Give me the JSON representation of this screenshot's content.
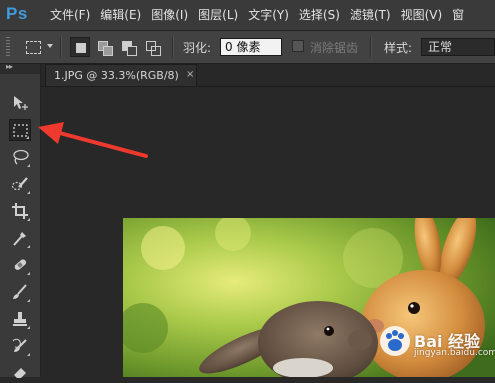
{
  "app": {
    "logo": "Ps"
  },
  "menu": {
    "items": [
      {
        "label": "文件(F)"
      },
      {
        "label": "编辑(E)"
      },
      {
        "label": "图像(I)"
      },
      {
        "label": "图层(L)"
      },
      {
        "label": "文字(Y)"
      },
      {
        "label": "选择(S)"
      },
      {
        "label": "滤镜(T)"
      },
      {
        "label": "视图(V)"
      },
      {
        "label": "窗"
      }
    ]
  },
  "options": {
    "feather_label": "羽化:",
    "feather_value": "0 像素",
    "antialias_label": "消除锯齿",
    "style_label": "样式:",
    "style_value": "正常"
  },
  "document": {
    "tab_title": "1.JPG @ 33.3%(RGB/8)",
    "tab_close": "×"
  },
  "watermark": {
    "text": "Bai 经验",
    "url": "jingyan.baidu.com"
  },
  "tools": [
    {
      "name": "move-tool",
      "icon": "move-arrow-icon"
    },
    {
      "name": "rectangular-marquee-tool",
      "icon": "dashed-rectangle-icon",
      "selected": true
    },
    {
      "name": "lasso-tool",
      "icon": "lasso-icon"
    },
    {
      "name": "quick-selection-tool",
      "icon": "quick-selection-brush-icon"
    },
    {
      "name": "crop-tool",
      "icon": "crop-icon"
    },
    {
      "name": "eyedropper-tool",
      "icon": "eyedropper-icon"
    },
    {
      "name": "healing-brush-tool",
      "icon": "bandage-icon"
    },
    {
      "name": "brush-tool",
      "icon": "brush-icon"
    },
    {
      "name": "clone-stamp-tool",
      "icon": "stamp-icon"
    },
    {
      "name": "history-brush-tool",
      "icon": "history-brush-icon"
    },
    {
      "name": "eraser-tool",
      "icon": "eraser-icon"
    }
  ],
  "colors": {
    "menubar": "#3a3a3a",
    "options_bar": "#424242",
    "workspace": "#282828",
    "annotation_arrow": "#ee3a2e",
    "ps_logo": "#3f9bdc"
  }
}
